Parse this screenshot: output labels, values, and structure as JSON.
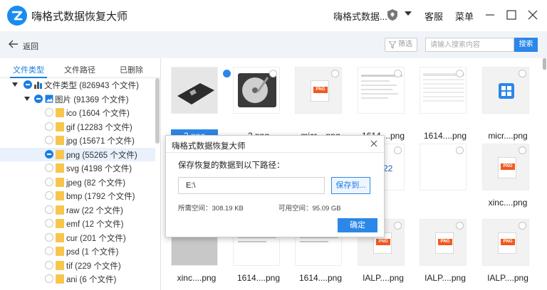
{
  "app": {
    "title": "嗨格式数据恢复大师",
    "account": "嗨格式数据...",
    "support": "客服",
    "menu": "菜单"
  },
  "toolbar": {
    "back": "返回",
    "filter": "筛选",
    "search_placeholder": "请输入搜索内容",
    "search_button": "搜索"
  },
  "tabs": [
    "文件类型",
    "文件路径",
    "已删除"
  ],
  "tree": {
    "root": "文件类型 (826943 个文件)",
    "images": "图片 (91369 个文件)",
    "items": [
      "ico (1604 个文件)",
      "gif (12283 个文件)",
      "jpg (15671 个文件)",
      "png (55265 个文件)",
      "svg (4198 个文件)",
      "jpeg (82 个文件)",
      "bmp (1792 个文件)",
      "raw (22 个文件)",
      "emf (12 个文件)",
      "cur (201 个文件)",
      "psd (1 个文件)",
      "tif (229 个文件)",
      "ani (6 个文件)"
    ]
  },
  "files": {
    "row1": [
      "3.png",
      "2.png",
      "micr....png",
      "1614....png",
      "1614....png",
      "micr....png"
    ],
    "row2_right": "xinc....png",
    "row2_partial_text": "22",
    "row3": [
      "xinc....png",
      "1614....png",
      "1614....png",
      "IALP....png",
      "IALP....png",
      "IALP....png"
    ],
    "badge": "PNG"
  },
  "dialog": {
    "title": "嗨格式数据恢复大师",
    "message": "保存恢复的数据到以下路径：",
    "path": "E:\\",
    "save_to": "保存到...",
    "required_space": "所需空间：308.19 KB",
    "free_space": "可用空间：95.09 GB",
    "ok": "确定"
  }
}
